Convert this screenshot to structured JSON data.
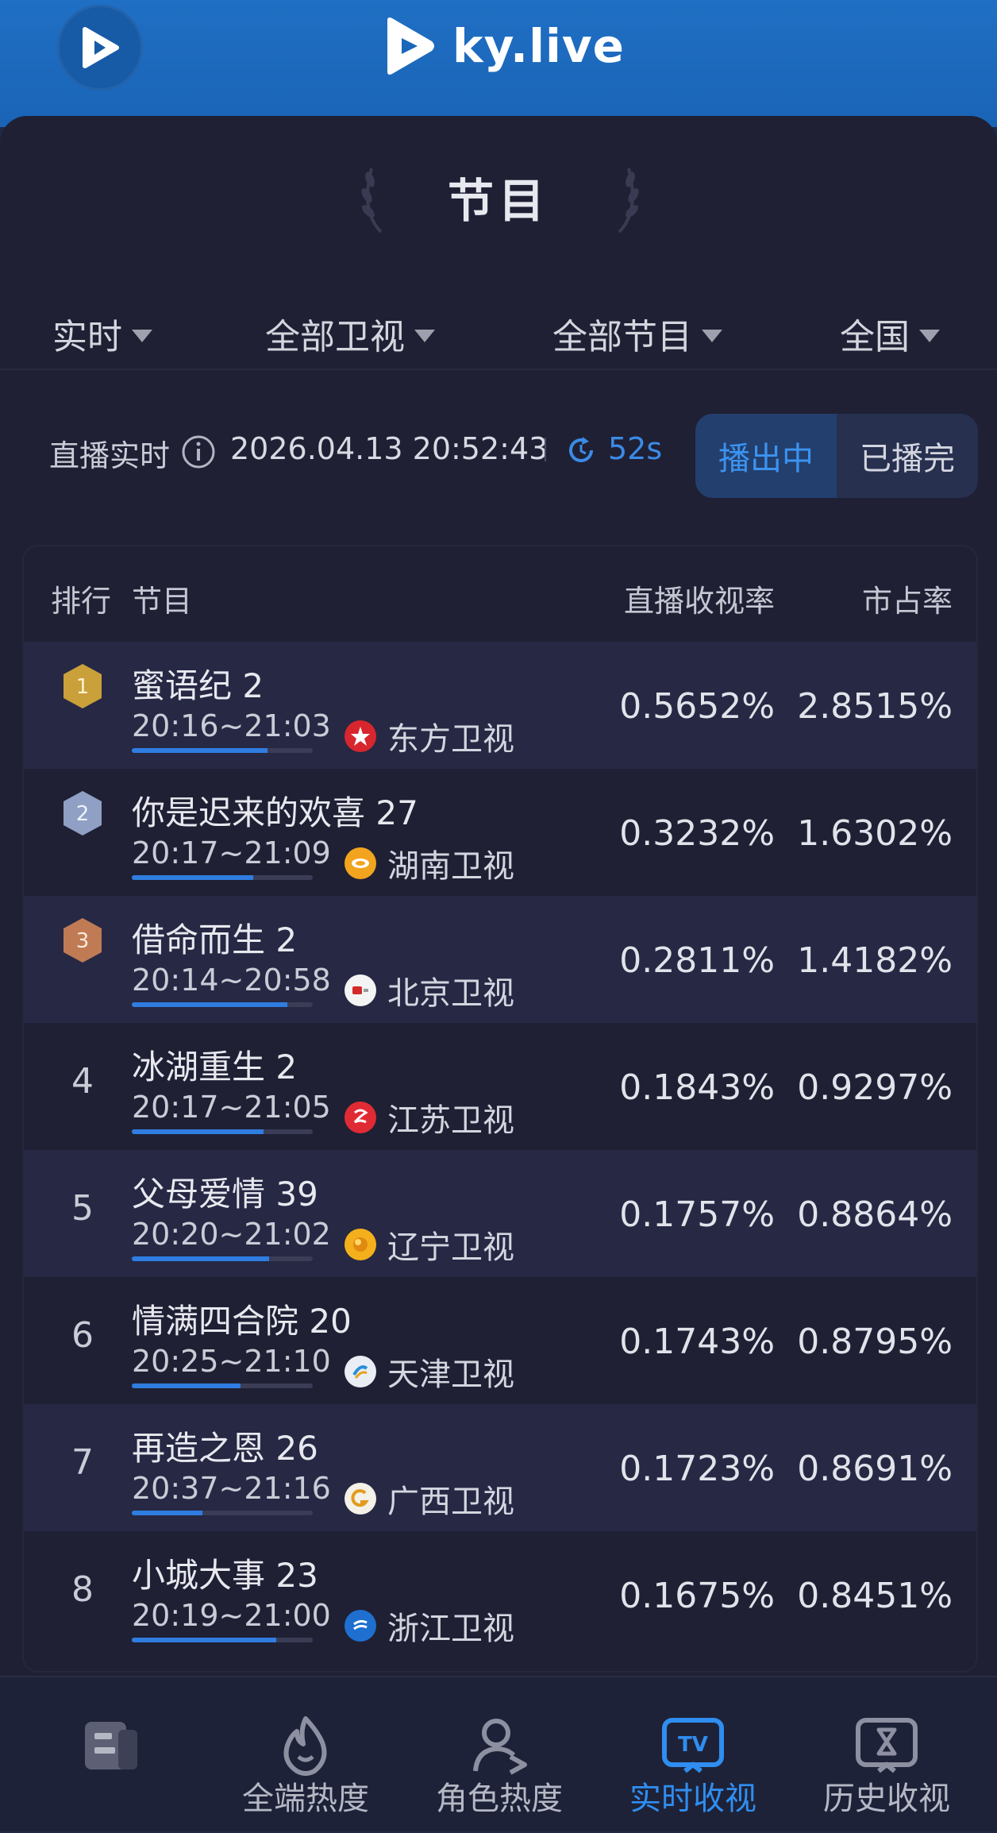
{
  "header": {
    "brand": "ky.live"
  },
  "section": {
    "title": "节目"
  },
  "filters": [
    {
      "label": "实时"
    },
    {
      "label": "全部卫视"
    },
    {
      "label": "全部节目"
    },
    {
      "label": "全国"
    }
  ],
  "status": {
    "label": "直播实时",
    "datetime": "2026.04.13 20:52:43",
    "refresh": "52s",
    "toggle_on_air": "播出中",
    "toggle_finished": "已播完"
  },
  "table": {
    "headers": {
      "rank": "排行",
      "program": "节目",
      "rating": "直播收视率",
      "share": "市占率"
    },
    "rows": [
      {
        "rank": "1",
        "title": "蜜语纪 2",
        "time": "20:16~21:03",
        "channel": "东方卫视",
        "rating": "0.5652%",
        "share": "2.8515%",
        "progress": 0.75
      },
      {
        "rank": "2",
        "title": "你是迟来的欢喜 27",
        "time": "20:17~21:09",
        "channel": "湖南卫视",
        "rating": "0.3232%",
        "share": "1.6302%",
        "progress": 0.67
      },
      {
        "rank": "3",
        "title": "借命而生 2",
        "time": "20:14~20:58",
        "channel": "北京卫视",
        "rating": "0.2811%",
        "share": "1.4182%",
        "progress": 0.86
      },
      {
        "rank": "4",
        "title": "冰湖重生 2",
        "time": "20:17~21:05",
        "channel": "江苏卫视",
        "rating": "0.1843%",
        "share": "0.9297%",
        "progress": 0.73
      },
      {
        "rank": "5",
        "title": "父母爱情 39",
        "time": "20:20~21:02",
        "channel": "辽宁卫视",
        "rating": "0.1757%",
        "share": "0.8864%",
        "progress": 0.76
      },
      {
        "rank": "6",
        "title": "情满四合院 20",
        "time": "20:25~21:10",
        "channel": "天津卫视",
        "rating": "0.1743%",
        "share": "0.8795%",
        "progress": 0.6
      },
      {
        "rank": "7",
        "title": "再造之恩 26",
        "time": "20:37~21:16",
        "channel": "广西卫视",
        "rating": "0.1723%",
        "share": "0.8691%",
        "progress": 0.39
      },
      {
        "rank": "8",
        "title": "小城大事 23",
        "time": "20:19~21:00",
        "channel": "浙江卫视",
        "rating": "0.1675%",
        "share": "0.8451%",
        "progress": 0.8
      }
    ]
  },
  "nav": [
    {
      "label": "",
      "icon": "list-icon"
    },
    {
      "label": "全端热度",
      "icon": "flame-icon"
    },
    {
      "label": "角色热度",
      "icon": "user-icon"
    },
    {
      "label": "实时收视",
      "icon": "tv-icon"
    },
    {
      "label": "历史收视",
      "icon": "history-icon"
    }
  ],
  "colors": {
    "header_blue": "#1f6fc4",
    "accent_blue": "#2f8ef0",
    "panel_bg": "#1f2034",
    "row_alt": "#262844",
    "gold": "#c9a03a",
    "silver": "#8fa0c4",
    "bronze": "#c07b55"
  }
}
